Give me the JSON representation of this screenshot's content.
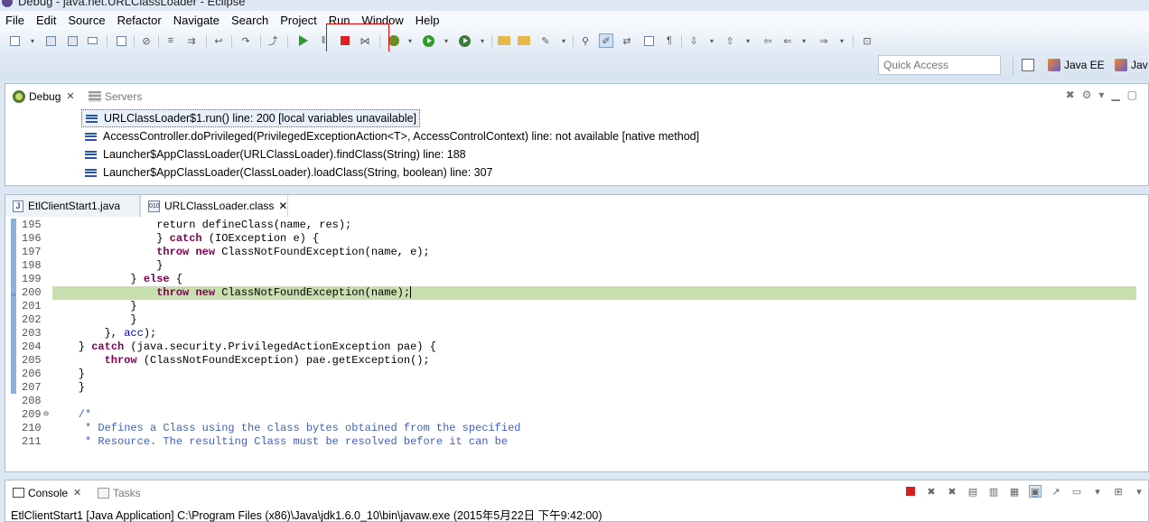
{
  "window": {
    "title": "Debug - java.net.URLClassLoader - Eclipse"
  },
  "menu": [
    "File",
    "Edit",
    "Source",
    "Refactor",
    "Navigate",
    "Search",
    "Project",
    "Run",
    "Window",
    "Help"
  ],
  "quick_access": {
    "placeholder": "Quick Access"
  },
  "perspectives": [
    "Java EE",
    "Jav"
  ],
  "debug_view": {
    "tabs": [
      {
        "label": "Debug",
        "active": true
      },
      {
        "label": "Servers",
        "active": false
      }
    ],
    "stack_frames": [
      "URLClassLoader$1.run() line: 200 [local variables unavailable]",
      "AccessController.doPrivileged(PrivilegedExceptionAction<T>, AccessControlContext) line: not available [native method]",
      "Launcher$AppClassLoader(URLClassLoader).findClass(String) line: 188",
      "Launcher$AppClassLoader(ClassLoader).loadClass(String, boolean) line: 307"
    ]
  },
  "editor": {
    "tabs": [
      {
        "label": "EtlClientStart1.java",
        "active": false
      },
      {
        "label": "URLClassLoader.class",
        "active": true
      }
    ],
    "lines": [
      {
        "n": "195",
        "parts": [
          [
            "",
            "                return defineClass(name, res);"
          ]
        ]
      },
      {
        "n": "196",
        "parts": [
          [
            "",
            "                } "
          ],
          [
            "kw",
            "catch"
          ],
          [
            "",
            " (IOException e) {"
          ]
        ]
      },
      {
        "n": "197",
        "parts": [
          [
            "",
            "                "
          ],
          [
            "kw",
            "throw"
          ],
          [
            "",
            " "
          ],
          [
            "kw",
            "new"
          ],
          [
            "",
            " ClassNotFoundException(name, e);"
          ]
        ]
      },
      {
        "n": "198",
        "parts": [
          [
            "",
            "                }"
          ]
        ]
      },
      {
        "n": "199",
        "parts": [
          [
            "",
            "            } "
          ],
          [
            "kw",
            "else"
          ],
          [
            "",
            " {"
          ]
        ]
      },
      {
        "n": "200",
        "current": true,
        "parts": [
          [
            "",
            "                "
          ],
          [
            "kw",
            "throw"
          ],
          [
            "",
            " "
          ],
          [
            "kw",
            "new"
          ],
          [
            "",
            " ClassNotFoundException(name);"
          ]
        ]
      },
      {
        "n": "201",
        "parts": [
          [
            "",
            "            }"
          ]
        ]
      },
      {
        "n": "202",
        "parts": [
          [
            "",
            "            }"
          ]
        ]
      },
      {
        "n": "203",
        "parts": [
          [
            "",
            "        }, "
          ],
          [
            "fld",
            "acc"
          ],
          [
            "",
            ");"
          ]
        ]
      },
      {
        "n": "204",
        "parts": [
          [
            "",
            "    } "
          ],
          [
            "kw",
            "catch"
          ],
          [
            "",
            " (java.security.PrivilegedActionException pae) {"
          ]
        ]
      },
      {
        "n": "205",
        "parts": [
          [
            "",
            "        "
          ],
          [
            "kw",
            "throw"
          ],
          [
            "",
            " (ClassNotFoundException) pae.getException();"
          ]
        ]
      },
      {
        "n": "206",
        "parts": [
          [
            "",
            "    }"
          ]
        ]
      },
      {
        "n": "207",
        "parts": [
          [
            "",
            "    }"
          ]
        ]
      },
      {
        "n": "208",
        "parts": [
          [
            "",
            ""
          ]
        ]
      },
      {
        "n": "209",
        "fold": true,
        "parts": [
          [
            "cm",
            "    /*"
          ]
        ]
      },
      {
        "n": "210",
        "parts": [
          [
            "cm",
            "     * Defines a Class using the class bytes obtained from the specified"
          ]
        ]
      },
      {
        "n": "211",
        "parts": [
          [
            "cm",
            "     * Resource. The resulting Class must be resolved before it can be"
          ]
        ]
      }
    ]
  },
  "console_view": {
    "tabs": [
      {
        "label": "Console",
        "active": true
      },
      {
        "label": "Tasks",
        "active": false
      }
    ],
    "status": "EtlClientStart1 [Java Application] C:\\Program Files (x86)\\Java\\jdk1.6.0_10\\bin\\javaw.exe (2015年5月22日 下午9:42:00)"
  },
  "colors": {
    "stop_button": "#e0201c",
    "highlight_box": "#e60000",
    "current_line": "#c8e0b0"
  }
}
